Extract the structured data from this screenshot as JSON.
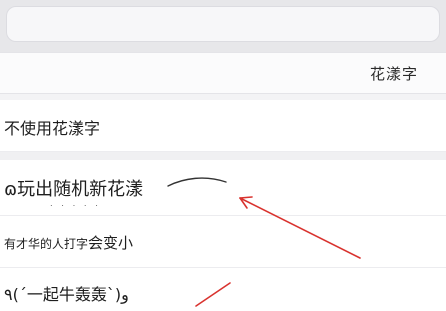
{
  "search": {
    "value": ""
  },
  "header": {
    "title": "花漾字"
  },
  "options": {
    "none": {
      "label": "不使用花漾字"
    },
    "style1": {
      "label": "ɷ玩出随机新花漾 ᠌"
    },
    "style2": {
      "label_small": "有才华的人打字",
      "label_large": "会变小"
    },
    "style3": {
      "label": "٩(ˊ一起牛轰轰ˋ)و"
    }
  },
  "colors": {
    "annotation_red": "#d9332f",
    "selected_text": "#1e1e1e"
  }
}
